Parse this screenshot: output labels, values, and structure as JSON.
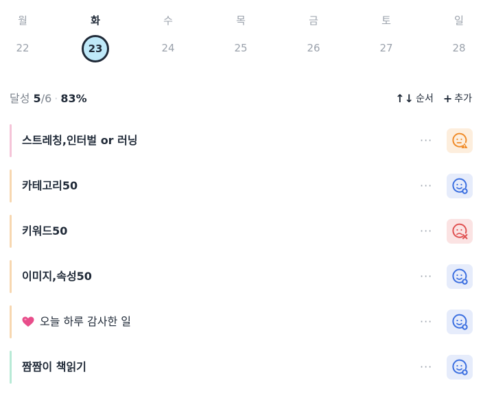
{
  "week": {
    "days": [
      {
        "name": "월",
        "num": "22",
        "selected": false
      },
      {
        "name": "화",
        "num": "23",
        "selected": true
      },
      {
        "name": "수",
        "num": "24",
        "selected": false
      },
      {
        "name": "목",
        "num": "25",
        "selected": false
      },
      {
        "name": "금",
        "num": "26",
        "selected": false
      },
      {
        "name": "토",
        "num": "27",
        "selected": false
      },
      {
        "name": "일",
        "num": "28",
        "selected": false
      }
    ]
  },
  "summary": {
    "label": "달성",
    "done": "5",
    "total": "/6",
    "dot": "·",
    "percent": "83%"
  },
  "actions": {
    "sort_icon": "↑↓",
    "sort_label": "순서",
    "add_icon": "+",
    "add_label": "추가"
  },
  "tasks": [
    {
      "title": "스트레칭,인터벌 or 러닝",
      "bar_color": "#f5c4d8",
      "status": "warn",
      "status_icon": "face-warning-icon",
      "more": "···"
    },
    {
      "title": "카테고리50",
      "bar_color": "#f7d7b0",
      "status": "ok",
      "status_icon": "face-check-icon",
      "more": "···"
    },
    {
      "title": "키워드50",
      "bar_color": "#f7d7b0",
      "status": "fail",
      "status_icon": "face-x-icon",
      "more": "···"
    },
    {
      "title": "이미지,속성50",
      "bar_color": "#f7d7b0",
      "status": "ok",
      "status_icon": "face-check-icon",
      "more": "···"
    },
    {
      "title": "오늘 하루 감사한 일",
      "bar_color": "#f7d7b0",
      "status": "ok",
      "status_icon": "face-check-icon",
      "more": "···",
      "emoji": "heart-icon"
    },
    {
      "title": "짬짬이 책읽기",
      "bar_color": "#b8ead6",
      "status": "ok",
      "status_icon": "face-check-icon",
      "more": "···"
    }
  ],
  "colors": {
    "warn": "#f08c2a",
    "ok": "#3b6fe0",
    "fail": "#e05252",
    "selected_fill": "#bfe9f9"
  }
}
